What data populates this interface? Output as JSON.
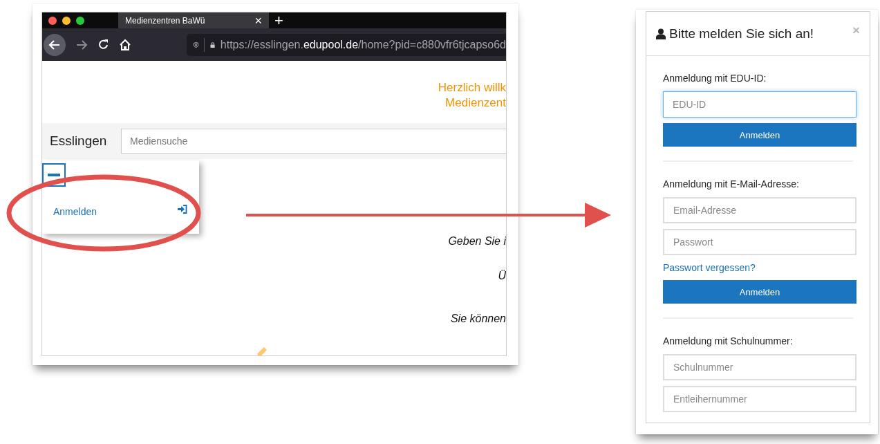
{
  "browser": {
    "tab": {
      "title": "Medienzentren BaWü",
      "close": "×",
      "new_tab": "+"
    },
    "url": {
      "prefix": "https://esslingen.",
      "domain": "edupool.de",
      "path": "/home?pid=c880vfr6tjcapso6d"
    },
    "welcome_lines": [
      "Herzlich willk",
      "Medienzent"
    ],
    "site_name": "Esslingen",
    "search": {
      "placeholder": "Mediensuche"
    },
    "menu": {
      "expanded": true,
      "items": [
        {
          "label": "Anmelden"
        }
      ]
    },
    "body_lines": [
      "Geben Sie i",
      "Ü",
      "Sie können"
    ]
  },
  "login_dialog": {
    "title": "Bitte melden Sie sich an!",
    "close": "×",
    "sections": [
      {
        "label": "Anmeldung mit EDU-ID:",
        "fields": [
          {
            "placeholder": "EDU-ID",
            "focused": true
          }
        ],
        "button": "Anmelden"
      },
      {
        "label": "Anmeldung mit E-Mail-Adresse:",
        "fields": [
          {
            "placeholder": "Email-Adresse",
            "focused": false
          },
          {
            "placeholder": "Passwort",
            "focused": false
          }
        ],
        "link": "Passwort vergessen?",
        "button": "Anmelden"
      },
      {
        "label": "Anmeldung mit Schulnummer:",
        "fields": [
          {
            "placeholder": "Schulnummer",
            "focused": false
          },
          {
            "placeholder": "Entleihernummer",
            "focused": false
          }
        ]
      }
    ]
  }
}
